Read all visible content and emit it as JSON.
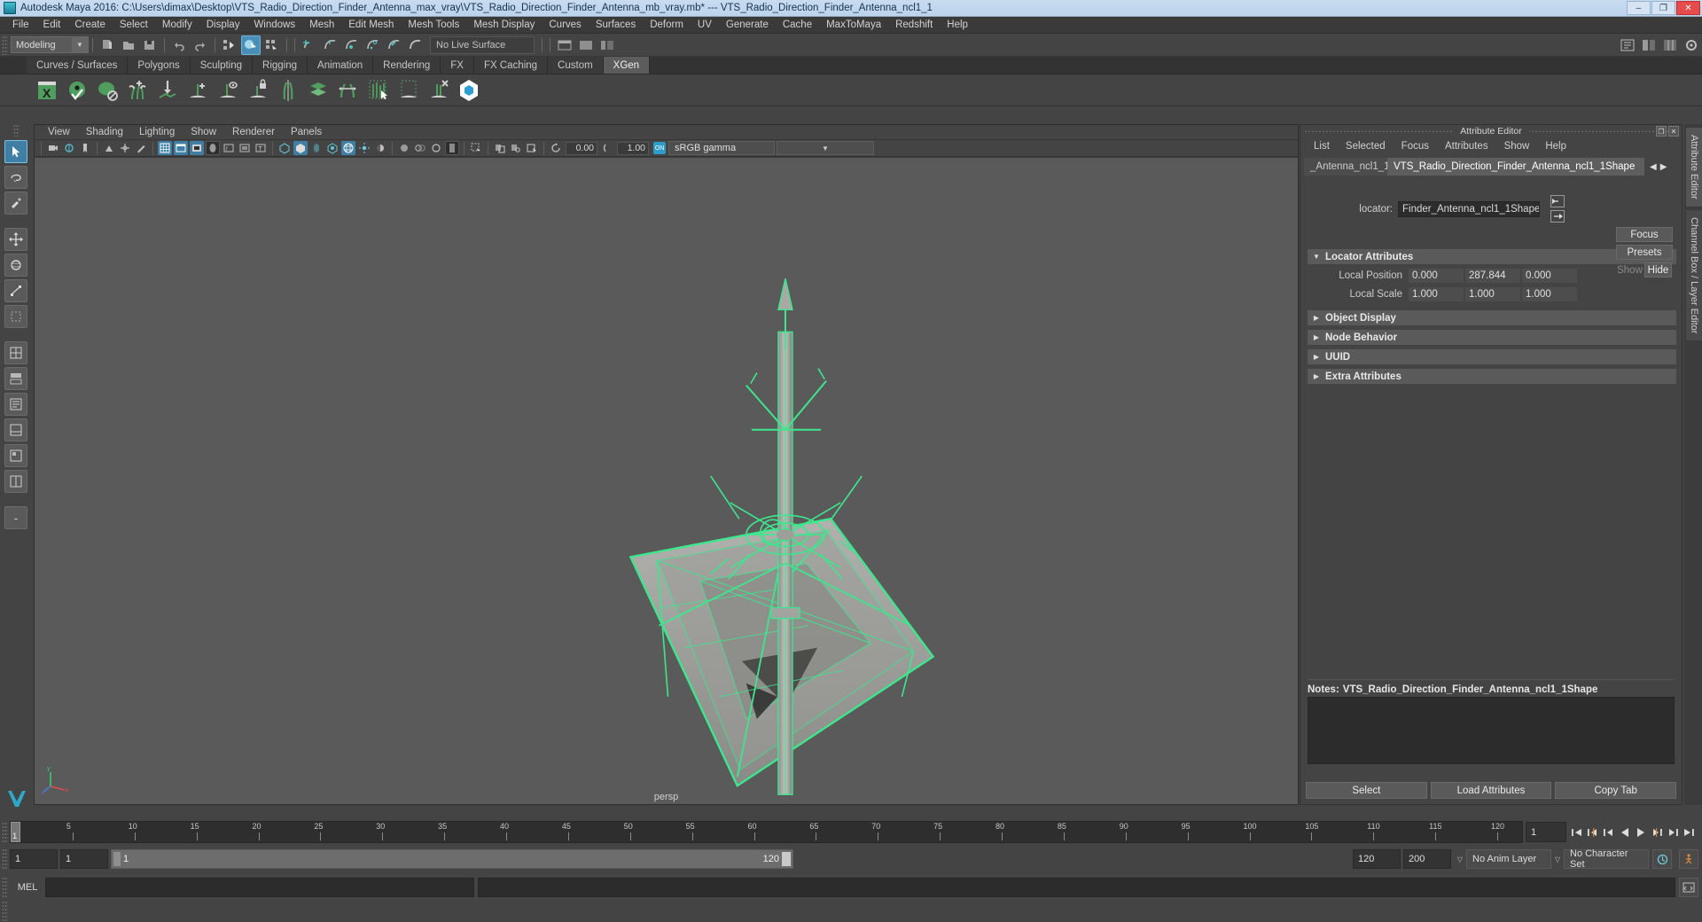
{
  "titlebar": {
    "app_title": "Autodesk Maya 2016: C:\\Users\\dimax\\Desktop\\VTS_Radio_Direction_Finder_Antenna_max_vray\\VTS_Radio_Direction_Finder_Antenna_mb_vray.mb*  ---  VTS_Radio_Direction_Finder_Antenna_ncl1_1",
    "minimize": "–",
    "maximize": "❐",
    "close": "✕"
  },
  "main_menu": [
    "File",
    "Edit",
    "Create",
    "Select",
    "Modify",
    "Display",
    "Windows",
    "Mesh",
    "Edit Mesh",
    "Mesh Tools",
    "Mesh Display",
    "Curves",
    "Surfaces",
    "Deform",
    "UV",
    "Generate",
    "Cache",
    "MaxToMaya",
    "Redshift",
    "Help"
  ],
  "statusline": {
    "menuset": "Modeling",
    "live_surface": "No Live Surface"
  },
  "shelf": {
    "tabs": [
      "Curves / Surfaces",
      "Polygons",
      "Sculpting",
      "Rigging",
      "Animation",
      "Rendering",
      "FX",
      "FX Caching",
      "Custom",
      "XGen"
    ],
    "selected_tab": "XGen",
    "icons": [
      "xgen-editor-icon",
      "xgen-preview-icon",
      "xgen-disable-preview-icon",
      "xgen-add-clumping-icon",
      "xgen-sculpt-icon",
      "xgen-add-guide-icon",
      "xgen-guide-visibility-icon",
      "xgen-lock-guide-icon",
      "xgen-mirror-guides-icon",
      "xgen-layers-icon",
      "xgen-convert-guides-icon",
      "xgen-select-density-icon",
      "xgen-region-icon",
      "xgen-delete-guide-icon",
      "xgen-archive-icon"
    ]
  },
  "toolbox": {
    "items": [
      {
        "name": "select-tool",
        "selected": true
      },
      {
        "name": "lasso-select-tool",
        "selected": false
      },
      {
        "name": "paint-select-tool",
        "selected": false
      },
      {
        "name": "move-tool",
        "selected": false
      },
      {
        "name": "rotate-tool",
        "selected": false
      },
      {
        "name": "scale-tool",
        "selected": false
      },
      {
        "name": "last-tool",
        "selected": false
      },
      {
        "name": "single-perspective-layout",
        "selected": false
      },
      {
        "name": "four-view-layout",
        "selected": false
      },
      {
        "name": "persp-outliner-layout",
        "selected": false
      },
      {
        "name": "persp-graph-layout",
        "selected": false
      },
      {
        "name": "hypershade-persp-layout",
        "selected": false
      },
      {
        "name": "persp-relationship-layout",
        "selected": false
      },
      {
        "name": "more-layouts",
        "selected": false
      }
    ]
  },
  "viewport": {
    "menus": [
      "View",
      "Shading",
      "Lighting",
      "Show",
      "Renderer",
      "Panels"
    ],
    "exposure_value": "0.00",
    "gamma_value": "1.00",
    "cms_toggle": "ON",
    "color_space": "sRGB gamma",
    "camera_label": "persp"
  },
  "attribute_editor": {
    "panel_title": "Attribute Editor",
    "menus": [
      "List",
      "Selected",
      "Focus",
      "Attributes",
      "Show",
      "Help"
    ],
    "tabs": [
      {
        "label": "_Antenna_ncl1_1",
        "selected": false
      },
      {
        "label": "VTS_Radio_Direction_Finder_Antenna_ncl1_1Shape",
        "selected": true
      }
    ],
    "tab_prev": "◀",
    "tab_next": "▶",
    "node_type_label": "locator:",
    "node_name": "Finder_Antenna_ncl1_1Shape",
    "focus_button": "Focus",
    "presets_button": "Presets",
    "show_button": "Show",
    "hide_button": "Hide",
    "sections": [
      {
        "name": "Locator Attributes",
        "expanded": true
      },
      {
        "name": "Object Display",
        "expanded": false
      },
      {
        "name": "Node Behavior",
        "expanded": false
      },
      {
        "name": "UUID",
        "expanded": false
      },
      {
        "name": "Extra Attributes",
        "expanded": false
      }
    ],
    "locator_attributes": [
      {
        "label": "Local Position",
        "values": [
          "0.000",
          "287.844",
          "0.000"
        ]
      },
      {
        "label": "Local Scale",
        "values": [
          "1.000",
          "1.000",
          "1.000"
        ]
      }
    ],
    "notes_label": "Notes:",
    "notes_target": "VTS_Radio_Direction_Finder_Antenna_ncl1_1Shape",
    "notes_text": "",
    "footer_buttons": [
      "Select",
      "Load Attributes",
      "Copy Tab"
    ]
  },
  "right_rail": {
    "tabs": [
      "Attribute Editor",
      "Channel Box / Layer Editor"
    ]
  },
  "time_slider": {
    "ticks": [
      "5",
      "10",
      "15",
      "20",
      "25",
      "30",
      "35",
      "40",
      "45",
      "50",
      "55",
      "60",
      "65",
      "70",
      "75",
      "80",
      "85",
      "90",
      "95",
      "100",
      "105",
      "110",
      "115",
      "120"
    ],
    "current_frame": "1",
    "current_frame_field": "1",
    "playback_buttons": [
      "go-to-start",
      "step-back-key",
      "step-back-frame",
      "play-backwards",
      "play-forwards",
      "step-forward-frame",
      "step-forward-key",
      "go-to-end"
    ]
  },
  "range_slider": {
    "anim_start": "1",
    "range_start": "1",
    "bar_start_label": "1",
    "bar_end_label": "120",
    "range_end": "120",
    "anim_end": "200",
    "anim_layer": "No Anim Layer",
    "character_set": "No Character Set"
  },
  "command_line": {
    "label": "MEL",
    "input_value": "",
    "output_value": ""
  },
  "colors": {
    "accent_blue": "#3f7fa5",
    "wireframe_green": "#3ee68c",
    "panel_bg": "#444444",
    "viewport_bg": "#5a5a5a",
    "title_bg": "#c8dcf0"
  }
}
